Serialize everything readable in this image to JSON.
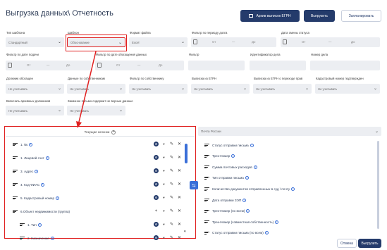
{
  "page": {
    "title": "Выгрузка данных\\ Отчетность"
  },
  "header_buttons": {
    "archive": "Архив выписок ЕГРН",
    "export": "Выгрузить",
    "schedule": "Запланировать"
  },
  "filters_row1": [
    {
      "label": "Тип шаблона",
      "value": "Стандартный"
    },
    {
      "label": "Шаблон",
      "value": "Обоснование"
    },
    {
      "label": "Формат файла",
      "value": "Excel"
    }
  ],
  "date_filters_row1": [
    {
      "label": "Фильтр по периоду долга",
      "from": "От",
      "to": "До"
    },
    {
      "label": "Дата смены статуса",
      "from": "От",
      "to": "До"
    }
  ],
  "date_filters_row2": [
    {
      "label": "Фильтр по дате подачи",
      "from": "От",
      "to": "До"
    },
    {
      "label": "Фильтр по дате обогащения данных",
      "from": "От",
      "to": "До"
    }
  ],
  "filters_row2_labels": {
    "filter": "Фильтр",
    "identifier": "Идентификатор дела",
    "case_number": "Номер дела"
  },
  "filters_row3": [
    {
      "label": "Должник обогащен",
      "value": "Не учитывать"
    },
    {
      "label": "Данные по собственникам",
      "value": "Не учитывать"
    },
    {
      "label": "Фильтр по собственнику",
      "value": "Не учитывать"
    },
    {
      "label": "Выписка из ЕГРН",
      "value": "Не учитывать"
    },
    {
      "label": "Выписка из ЕГРН о переходе прав",
      "value": "Не учитывать"
    },
    {
      "label": "Кадастровый номер подтвержден",
      "value": "Не учитывать"
    }
  ],
  "filters_row4": [
    {
      "label": "Включать архивных должников",
      "value": "Не учитывать"
    },
    {
      "label": "Заказное письмо содержит не верные данные",
      "value": "Не учитывать"
    }
  ],
  "current_columns": {
    "header": "Текущие колонки",
    "items": [
      {
        "label": "1. №"
      },
      {
        "label": "1. Лицевой счет"
      },
      {
        "label": "3. Адрес"
      },
      {
        "label": "4. Код ФИАС"
      },
      {
        "label": "5. Кадастровый номер"
      },
      {
        "label": "6.Объект недвижимости (группа)"
      },
      {
        "label": "1. Тип"
      },
      {
        "label": "2. Назначение"
      }
    ]
  },
  "source_select": {
    "value": "Почта России"
  },
  "available_columns": [
    "Статус отправки письма",
    "Трек-Номер",
    "Сумма почтовых расходов",
    "Тип отправки письма",
    "Количество документов отправленных в суд \\ почту",
    "Дата отправки ЗЭП",
    "Трек-Номер (по всем)",
    "Трек-Номер (совместная собственность)",
    "Статус отправки письма (по всем)"
  ],
  "footer": {
    "cancel": "Отмена",
    "export": "Выгрузить"
  },
  "colors": {
    "primary": "#243b6b",
    "accent": "#3a6fd8",
    "highlight": "#e02020",
    "field_bg": "#eceef2"
  }
}
